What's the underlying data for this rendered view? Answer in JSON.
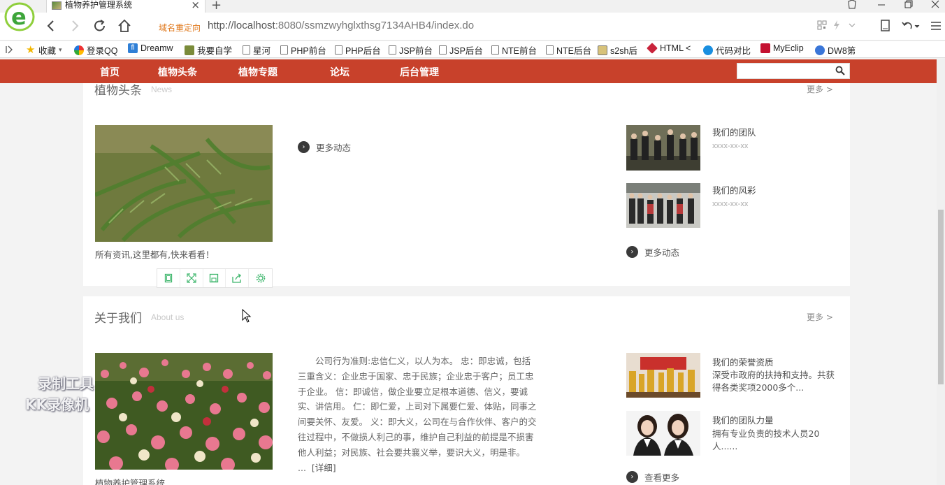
{
  "browser": {
    "tab_title": "植物养护管理系统",
    "new_tab": "+",
    "close_tab": "×",
    "redirect_label": "域名重定向",
    "url_host": "http://localhost",
    "url_rest": ":8080/ssmzwyhglxthsg7134AHB4/index.do",
    "bookmarks": [
      {
        "label": "收藏",
        "icon": "star-icon"
      },
      {
        "label": "登录QQ",
        "icon": "qq-icon"
      },
      {
        "label": "Dreamw",
        "icon": "dreamweaver-icon"
      },
      {
        "label": "我要自学",
        "icon": "book-icon"
      },
      {
        "label": "星河",
        "icon": "doc-icon"
      },
      {
        "label": "PHP前台",
        "icon": "doc-icon"
      },
      {
        "label": "PHP后台",
        "icon": "doc-icon"
      },
      {
        "label": "JSP前台",
        "icon": "doc-icon"
      },
      {
        "label": "JSP后台",
        "icon": "doc-icon"
      },
      {
        "label": "NTE前台",
        "icon": "doc-icon"
      },
      {
        "label": "NTE后台",
        "icon": "doc-icon"
      },
      {
        "label": "s2sh后",
        "icon": "image-icon"
      },
      {
        "label": "HTML <",
        "icon": "html-icon"
      },
      {
        "label": "代码对比",
        "icon": "compare-icon"
      },
      {
        "label": "MyEclip",
        "icon": "eclipse-icon"
      },
      {
        "label": "DW8第",
        "icon": "paw-icon"
      }
    ]
  },
  "nav": {
    "items": [
      "首页",
      "植物头条",
      "植物专题",
      "论坛",
      "后台管理"
    ],
    "search_placeholder": ""
  },
  "news": {
    "title": "植物头条",
    "subtitle": "News",
    "more": "更多 >",
    "caption": "所有资讯,这里都有,快来看看！",
    "more_news": "更多动态",
    "side_items": [
      {
        "title": "我们的团队",
        "date": "xxxx-xx-xx"
      },
      {
        "title": "我们的风彩",
        "date": "xxxx-xx-xx"
      }
    ],
    "side_more": "更多动态"
  },
  "about": {
    "title": "关于我们",
    "subtitle": "About us",
    "more": "更多 >",
    "caption": "植物养护管理系统",
    "text": "公司行为准则:忠信仁义，以人为本。 忠：即忠诚，包括三重含义：企业忠于国家、忠于民族；企业忠于客户；员工忠于企业。 信：即诚信，做企业要立足根本道德、信义，要诚实、讲信用。 仁：即仁爱，上司对下属要仁爱、体贴，同事之间要关怀、友爱。 义：即大义，公司在与合作伙伴、客户的交往过程中，不做损人利己的事，维护自己利益的前提是不损害他人利益；对民族、社会要共襄义举，要识大义，明是非。 ...",
    "detail": "[详细]",
    "side_items": [
      {
        "title": "我们的荣誉资质",
        "desc": "深受市政府的扶持和支持。共获得各类奖项2000多个..."
      },
      {
        "title": "我们的团队力量",
        "desc": "拥有专业负责的技术人员20人......"
      }
    ],
    "side_more": "查看更多"
  },
  "watermark": {
    "line1": "录制工具",
    "line2": "KK录像机"
  },
  "colors": {
    "nav_bg": "#c8412b",
    "redirect": "#e07a1f",
    "toolbar_icon": "#3bb56a"
  }
}
